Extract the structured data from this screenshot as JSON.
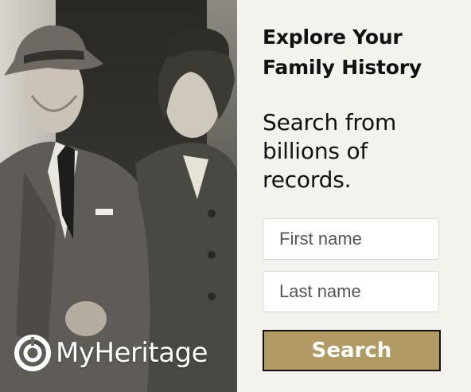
{
  "brand": {
    "name": "MyHeritage",
    "logo_icon": "myheritage-logo-icon"
  },
  "panel": {
    "title": "Explore Your Family History",
    "subtitle": "Search from billions of records."
  },
  "form": {
    "first_name_placeholder": "First name",
    "last_name_placeholder": "Last name",
    "search_label": "Search"
  },
  "colors": {
    "panel_bg": "#f4f2ec",
    "button_bg": "#b19b63",
    "button_border": "#111111",
    "text": "#111111"
  }
}
